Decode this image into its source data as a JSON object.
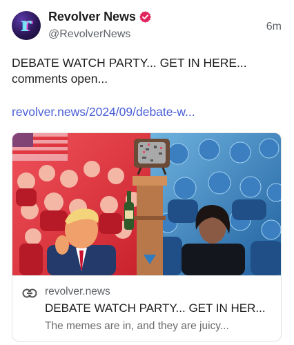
{
  "author": {
    "display_name": "Revolver News",
    "handle": "@RevolverNews",
    "avatar_letter": "r",
    "verified_icon": "verified-badge-icon",
    "verified_color": "#e0245e"
  },
  "post": {
    "timestamp": "6m",
    "text_line1": "DEBATE WATCH PARTY... GET IN HERE...",
    "text_line2": "comments open...",
    "link_text": "revolver.news/2024/09/debate-w...",
    "link_color": "#4a5fd6"
  },
  "card": {
    "icon": "link-icon",
    "domain": "revolver.news",
    "title": "DEBATE WATCH PARTY... GET IN HER...",
    "description": "The memes are in, and they are juicy..."
  },
  "colors": {
    "left_side": "#e2343f",
    "right_side": "#2e7ec9"
  }
}
